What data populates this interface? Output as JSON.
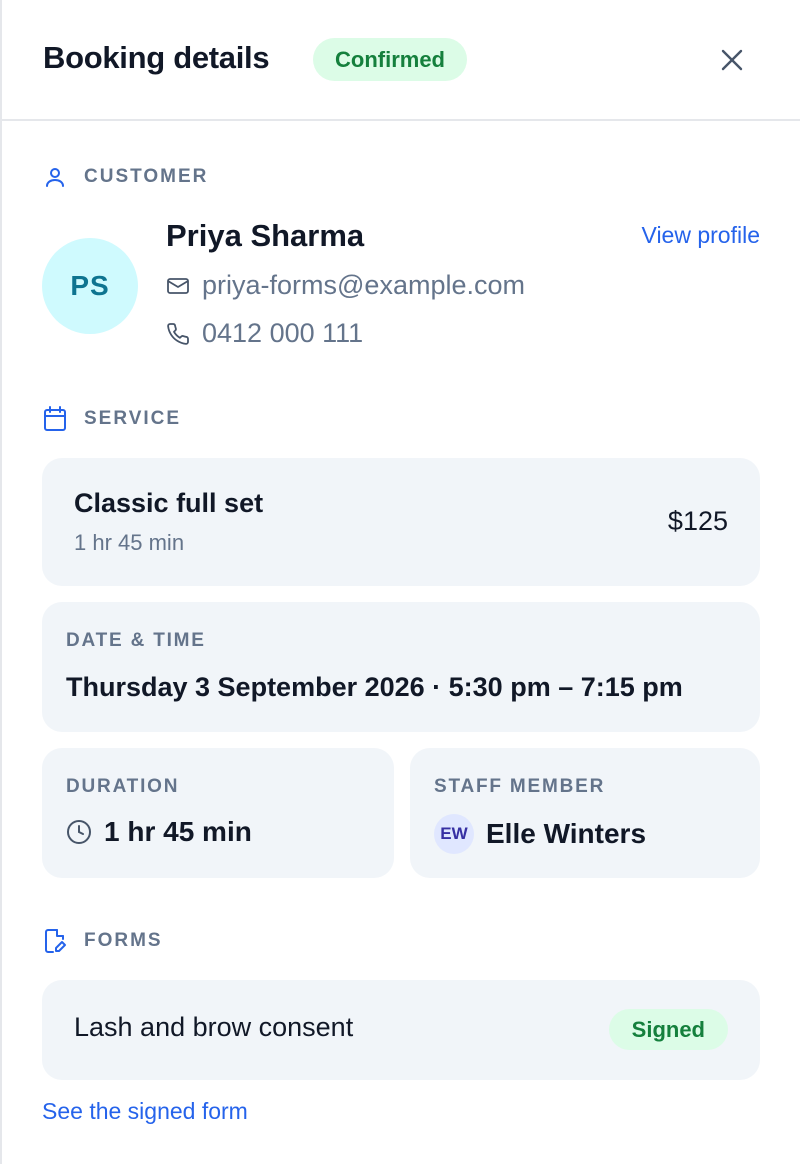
{
  "header": {
    "title": "Booking details",
    "status": "Confirmed",
    "close_icon": "close-icon"
  },
  "customer": {
    "section_label": "CUSTOMER",
    "initials": "PS",
    "name": "Priya Sharma",
    "view_profile": "View profile",
    "email": "priya-forms@example.com",
    "phone": "0412 000 111"
  },
  "service": {
    "section_label": "SERVICE",
    "name": "Classic full set",
    "duration": "1 hr 45 min",
    "price": "$125"
  },
  "datetime": {
    "label": "DATE & TIME",
    "value": "Thursday 3 September 2026 · 5:30 pm – 7:15 pm"
  },
  "duration": {
    "label": "DURATION",
    "value": "1 hr 45 min"
  },
  "staff": {
    "label": "STAFF MEMBER",
    "initials": "EW",
    "name": "Elle Winters"
  },
  "forms": {
    "section_label": "FORMS",
    "items": [
      {
        "name": "Lash and brow consent",
        "status": "Signed"
      }
    ],
    "see_link": "See the signed form"
  },
  "colors": {
    "accent": "#2563eb",
    "success_bg": "#dcfce7",
    "success_text": "#15803d",
    "card_bg": "#f1f5f9",
    "muted": "#64748b"
  }
}
